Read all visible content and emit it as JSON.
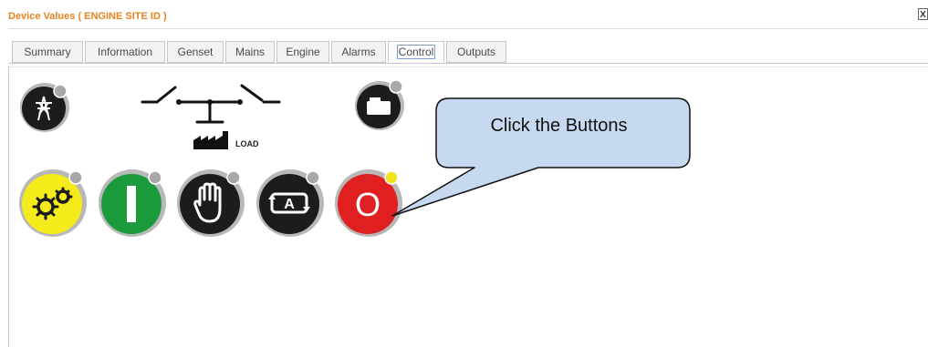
{
  "window": {
    "title": "Device Values ( ENGINE SITE ID )",
    "close_label": "X"
  },
  "tabs": [
    {
      "label": "Summary",
      "active": false
    },
    {
      "label": "Information",
      "active": false
    },
    {
      "label": "Genset",
      "active": false
    },
    {
      "label": "Mains",
      "active": false
    },
    {
      "label": "Engine",
      "active": false
    },
    {
      "label": "Alarms",
      "active": false
    },
    {
      "label": "Control",
      "active": true
    },
    {
      "label": "Outputs",
      "active": false
    }
  ],
  "diagram": {
    "load_label": "LOAD",
    "mains_icon": "power-pylon-icon",
    "generator_icon": "generator-icon",
    "switch_icon": "transfer-switch-icon",
    "load_icon": "factory-icon"
  },
  "controls": [
    {
      "name": "auto-mode",
      "icon": "gears-icon",
      "color": "#f5ea1a"
    },
    {
      "name": "start",
      "icon": "start-bar-icon",
      "color": "#1a9a3a"
    },
    {
      "name": "manual-mode",
      "icon": "hand-icon",
      "color": "#1a1a1a"
    },
    {
      "name": "test-mode",
      "icon": "auto-test-icon",
      "glyph": "A",
      "color": "#1a1a1a"
    },
    {
      "name": "stop",
      "icon": "stop-icon",
      "glyph": "O",
      "color": "#e02020"
    }
  ],
  "callout": {
    "text": "Click the Buttons",
    "fill": "#c6d9f1"
  }
}
